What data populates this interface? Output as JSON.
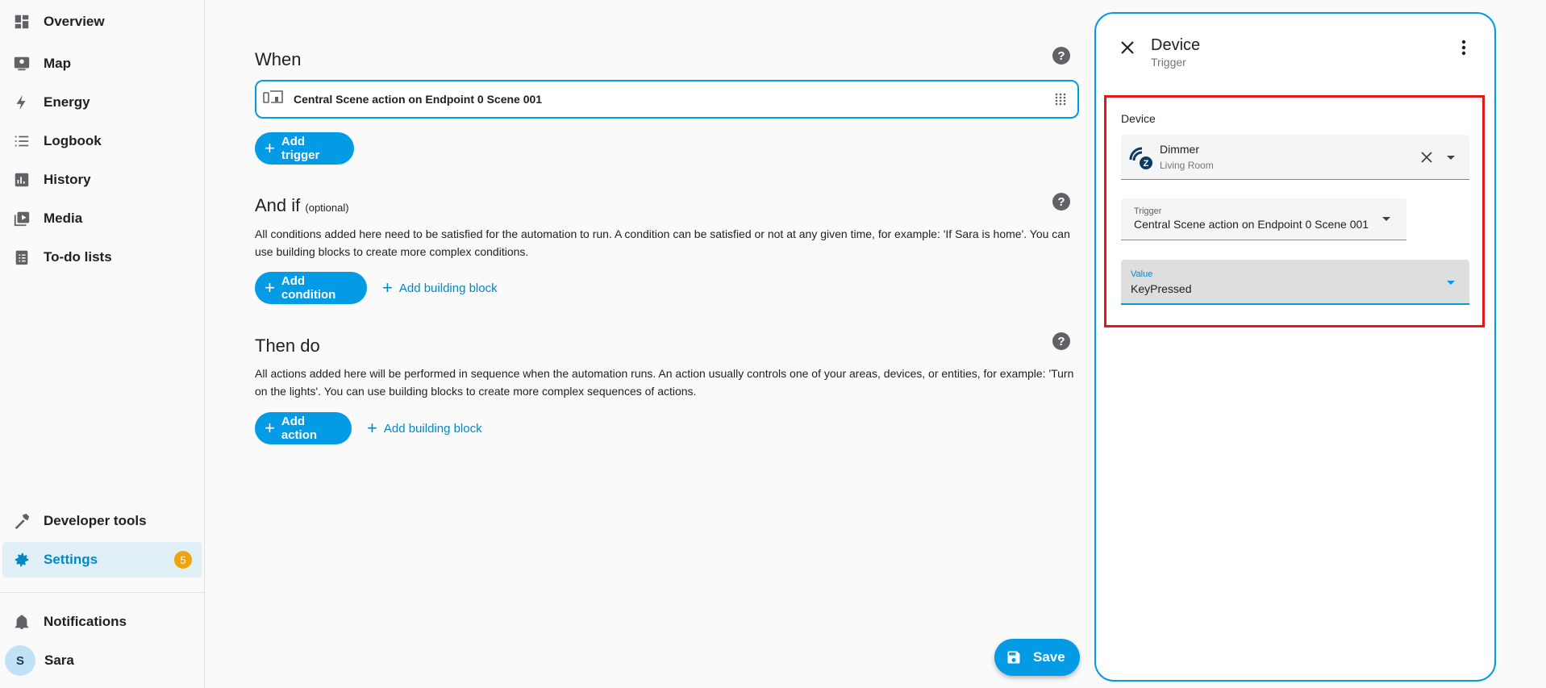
{
  "sidebar": {
    "items": [
      {
        "label": "Overview",
        "icon": "dashboard-icon"
      },
      {
        "label": "Map",
        "icon": "map-icon"
      },
      {
        "label": "Energy",
        "icon": "lightning-icon"
      },
      {
        "label": "Logbook",
        "icon": "list-icon"
      },
      {
        "label": "History",
        "icon": "chart-icon"
      },
      {
        "label": "Media",
        "icon": "media-icon"
      },
      {
        "label": "To-do lists",
        "icon": "clipboard-icon"
      }
    ],
    "developer_tools": "Developer tools",
    "settings": "Settings",
    "settings_badge": "5",
    "notifications": "Notifications",
    "user_name": "Sara",
    "user_initial": "S"
  },
  "main": {
    "when_title": "When",
    "trigger_label": "Central Scene action on Endpoint 0 Scene 001",
    "add_trigger": "Add trigger",
    "andif_title": "And if",
    "andif_optional": "(optional)",
    "andif_desc": "All conditions added here need to be satisfied for the automation to run. A condition can be satisfied or not at any given time, for example: 'If Sara is home'. You can use building blocks to create more complex conditions.",
    "add_condition": "Add condition",
    "add_building_block": "Add building block",
    "then_title": "Then do",
    "then_desc": "All actions added here will be performed in sequence when the automation runs. An action usually controls one of your areas, devices, or entities, for example: 'Turn on the lights'. You can use building blocks to create more complex sequences of actions.",
    "add_action": "Add action",
    "help": "?",
    "save": "Save"
  },
  "panel": {
    "title": "Device",
    "subtitle": "Trigger",
    "device_label": "Device",
    "device_name": "Dimmer",
    "device_area": "Living Room",
    "trigger_label": "Trigger",
    "trigger_value": "Central Scene action on Endpoint 0 Scene 001",
    "value_label": "Value",
    "value_value": "KeyPressed"
  },
  "colors": {
    "accent": "#039be5",
    "highlight": "#e0191c",
    "badge": "#f0a30a"
  }
}
